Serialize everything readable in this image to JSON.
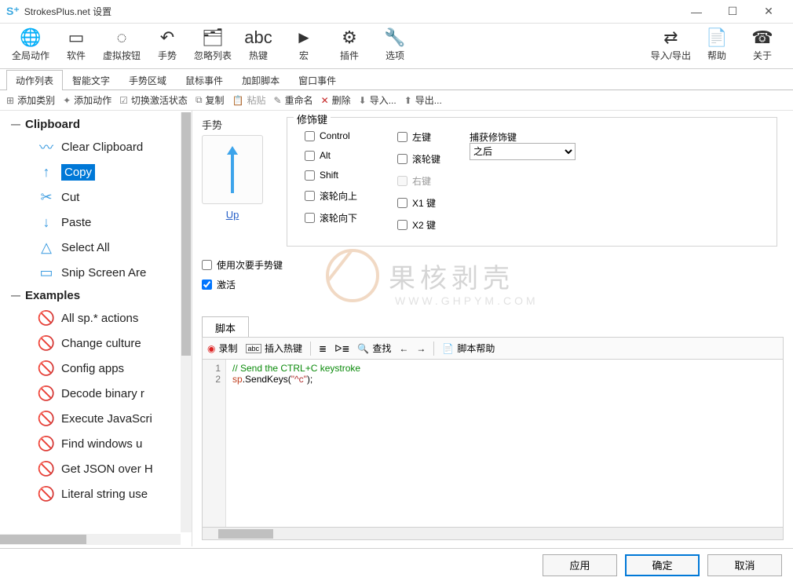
{
  "window": {
    "title": "StrokesPlus.net 设置"
  },
  "toolbar": [
    {
      "id": "global",
      "label": "全局动作",
      "icon": "globe"
    },
    {
      "id": "software",
      "label": "软件",
      "icon": "window"
    },
    {
      "id": "vbutton",
      "label": "虚拟按钮",
      "icon": "loader"
    },
    {
      "id": "gesture",
      "label": "手势",
      "icon": "undo"
    },
    {
      "id": "ignore",
      "label": "忽略列表",
      "icon": "stack"
    },
    {
      "id": "hotkey",
      "label": "热键",
      "icon": "abc"
    },
    {
      "id": "macro",
      "label": "宏",
      "icon": "macro"
    },
    {
      "id": "plugin",
      "label": "插件",
      "icon": "plugin"
    },
    {
      "id": "options",
      "label": "选项",
      "icon": "wrench"
    }
  ],
  "toolbar_right": [
    {
      "id": "ie",
      "label": "导入/导出",
      "icon": "ie"
    },
    {
      "id": "help",
      "label": "帮助",
      "icon": "help"
    },
    {
      "id": "about",
      "label": "关于",
      "icon": "about"
    }
  ],
  "tabs": [
    {
      "id": "actionlist",
      "label": "动作列表",
      "active": true
    },
    {
      "id": "smarttext",
      "label": "智能文字"
    },
    {
      "id": "gesturearea",
      "label": "手势区域"
    },
    {
      "id": "mouseevent",
      "label": "鼠标事件"
    },
    {
      "id": "loadscript",
      "label": "加卸脚本"
    },
    {
      "id": "windowevent",
      "label": "窗口事件"
    }
  ],
  "actionbar": [
    {
      "id": "addcat",
      "label": "添加类别"
    },
    {
      "id": "addaction",
      "label": "添加动作"
    },
    {
      "id": "togglestate",
      "label": "切换激活状态"
    },
    {
      "id": "copy",
      "label": "复制"
    },
    {
      "id": "paste",
      "label": "粘贴",
      "disabled": true
    },
    {
      "id": "rename",
      "label": "重命名"
    },
    {
      "id": "delete",
      "label": "删除",
      "red": true
    },
    {
      "id": "import",
      "label": "导入..."
    },
    {
      "id": "export",
      "label": "导出..."
    }
  ],
  "tree": [
    {
      "name": "Clipboard",
      "items": [
        {
          "label": "Clear Clipboard",
          "icon": "zig"
        },
        {
          "label": "Copy",
          "icon": "up",
          "selected": true
        },
        {
          "label": "Cut",
          "icon": "scissors"
        },
        {
          "label": "Paste",
          "icon": "down"
        },
        {
          "label": "Select All",
          "icon": "triangle"
        },
        {
          "label": "Snip Screen Are",
          "icon": "rect"
        }
      ]
    },
    {
      "name": "Examples",
      "items": [
        {
          "label": "All sp.* actions",
          "icon": "no"
        },
        {
          "label": "Change culture",
          "icon": "no"
        },
        {
          "label": "Config apps",
          "icon": "no"
        },
        {
          "label": "Decode binary r",
          "icon": "no"
        },
        {
          "label": "Execute JavaScri",
          "icon": "no"
        },
        {
          "label": "Find windows u",
          "icon": "no"
        },
        {
          "label": "Get JSON over H",
          "icon": "no"
        },
        {
          "label": "Literal string use",
          "icon": "no"
        }
      ]
    }
  ],
  "panel": {
    "gesture_label": "手势",
    "gesture_link": "Up",
    "mod_label": "修饰键",
    "mods_col1": [
      {
        "label": "Control",
        "checked": false
      },
      {
        "label": "Alt",
        "checked": false
      },
      {
        "label": "Shift",
        "checked": false
      },
      {
        "label": "滚轮向上",
        "checked": false
      },
      {
        "label": "滚轮向下",
        "checked": false
      }
    ],
    "mods_col2": [
      {
        "label": "左键",
        "checked": false
      },
      {
        "label": "滚轮键",
        "checked": false
      },
      {
        "label": "右键",
        "checked": false,
        "disabled": true
      },
      {
        "label": "X1 键",
        "checked": false
      },
      {
        "label": "X2 键",
        "checked": false
      }
    ],
    "capture_label": "捕获修饰键",
    "capture_value": "之后",
    "secondary_label": "使用次要手势键",
    "secondary_checked": false,
    "activate_label": "激活",
    "activate_checked": true,
    "script_tab": "脚本",
    "script_toolbar": {
      "record": "录制",
      "inserthk": "插入热键",
      "find": "查找",
      "help": "脚本帮助"
    },
    "script_lines": [
      "1",
      "2"
    ],
    "script": {
      "comment": "// Send the CTRL+C keystroke",
      "call1": "sp",
      "call2": ".SendKeys(",
      "arg": "\"^c\"",
      "end": ");"
    }
  },
  "watermark": {
    "big": "果核剥壳",
    "sub": "WWW.GHPYM.COM"
  },
  "footer": {
    "apply": "应用",
    "ok": "确定",
    "cancel": "取消"
  }
}
